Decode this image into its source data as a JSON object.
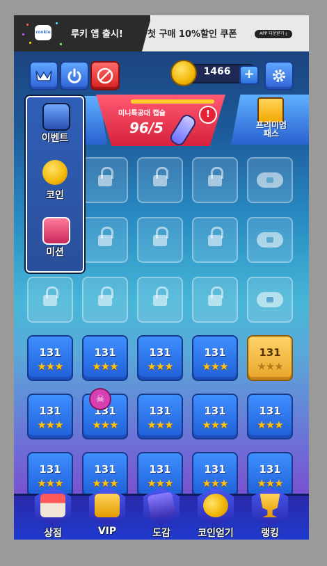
{
  "banner": {
    "logo_text": "rookie",
    "left_text": "루키 앱 출시!",
    "right_text": "첫 구매 10%할인 쿠폰",
    "app_button": "APP 다운받기 ⤓"
  },
  "top_bar": {
    "coin_value": "1466",
    "plus_label": "+",
    "icons": [
      "squad-icon",
      "power-icon",
      "no-ads-icon",
      "gear-icon"
    ]
  },
  "event": {
    "title": "미니특공대 캡슐",
    "count": "96/5",
    "alert": "!"
  },
  "pass": {
    "label": "프리미엄 패스"
  },
  "side_menu": {
    "items": [
      {
        "label": "이벤트",
        "icon": "event-icon"
      },
      {
        "label": "코인",
        "icon": "coin-stack-icon"
      },
      {
        "label": "미션",
        "icon": "ads-mission-icon"
      }
    ]
  },
  "levels": {
    "row4": [
      "131",
      "131",
      "131",
      "131",
      "131"
    ],
    "row5": [
      "131",
      "131",
      "131",
      "131",
      "131"
    ],
    "row6": [
      "131",
      "131",
      "131",
      "131",
      "131"
    ],
    "stars": "★★★",
    "skull": "☠"
  },
  "bottom_nav": {
    "items": [
      {
        "label": "상점",
        "icon": "shop-icon"
      },
      {
        "label": "VIP",
        "icon": "vip-icon"
      },
      {
        "label": "도감",
        "icon": "book-icon"
      },
      {
        "label": "코인얻기",
        "icon": "coins-icon"
      },
      {
        "label": "랭킹",
        "icon": "trophy-icon"
      }
    ]
  },
  "colors": {
    "level_blue": "#3f8fff",
    "level_gold": "#ffd36a",
    "event_red": "#d6213b",
    "coin_gold": "#f2b705"
  }
}
